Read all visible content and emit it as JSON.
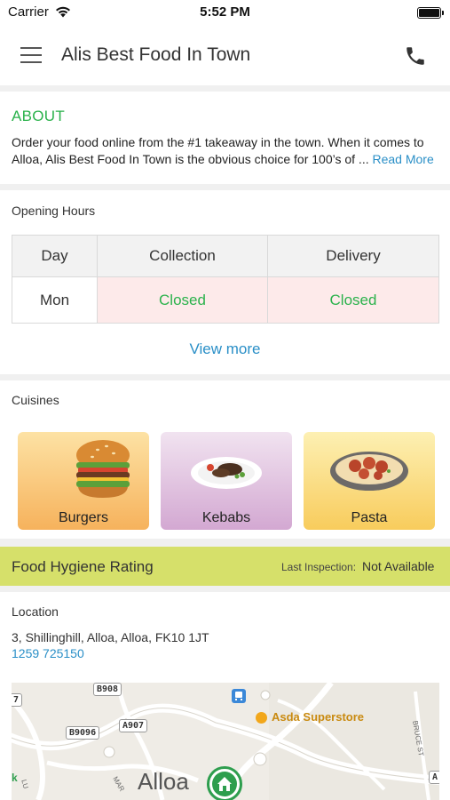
{
  "status_bar": {
    "carrier": "Carrier",
    "time": "5:52 PM"
  },
  "header": {
    "title": "Alis Best Food In Town"
  },
  "about": {
    "title": "ABOUT",
    "text": "Order your food online from the #1 takeaway in the town. When it comes to Alloa, Alis Best Food In Town is the obvious choice for 100’s of ...",
    "read_more": "Read More"
  },
  "opening_hours": {
    "label": "Opening Hours",
    "columns": [
      "Day",
      "Collection",
      "Delivery"
    ],
    "rows": [
      {
        "day": "Mon",
        "collection": "Closed",
        "delivery": "Closed"
      }
    ],
    "view_more": "View more"
  },
  "cuisines": {
    "label": "Cuisines",
    "items": [
      {
        "label": "Burgers"
      },
      {
        "label": "Kebabs"
      },
      {
        "label": "Pasta"
      }
    ]
  },
  "hygiene": {
    "title": "Food Hygiene Rating",
    "inspection_label": "Last Inspection:",
    "inspection_value": "Not Available"
  },
  "location": {
    "label": "Location",
    "address": "3, Shillinghill, Alloa, Alloa, FK10 1JT",
    "phone": "1259 725150"
  },
  "map": {
    "labels": {
      "b908": "B908",
      "a907": "A907",
      "b9096": "B9096",
      "town": "Alloa",
      "store": "Asda Superstore",
      "bruce_st": "BRUCE ST",
      "mar": "MAR",
      "a_edge": "A",
      "num7": "7",
      "k": "k",
      "lu": "LU"
    },
    "colors": {
      "road": "#ffffff",
      "background": "#efece6",
      "marker": "#2e9e4e",
      "store": "#f2a71b",
      "transit": "#3b88d8"
    }
  },
  "colors": {
    "accent_green": "#2bb24c",
    "link_blue": "#2a8fc7",
    "hygiene_bar": "#d6e06a",
    "closed_bg": "#fdeaea"
  }
}
